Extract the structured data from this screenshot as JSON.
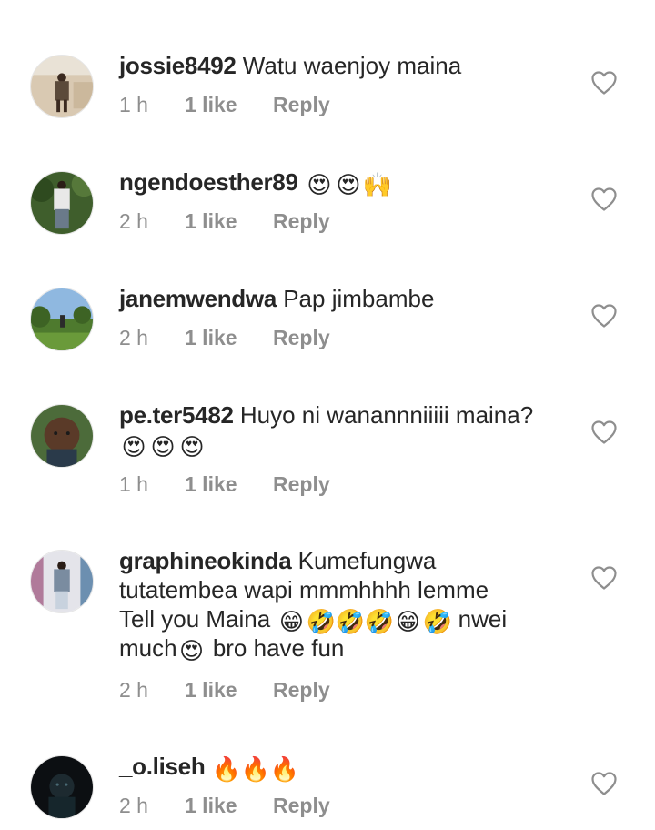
{
  "comments": [
    {
      "username": "jossie8492",
      "text": "Watu waenjoy maina",
      "emojis": [],
      "time": "1 h",
      "likes": "1 like",
      "reply": "Reply",
      "avatar_icon": "user-photo-avatar"
    },
    {
      "username": "ngendoesther89",
      "text": "",
      "emojis": [
        "😍",
        "😍",
        "🙌"
      ],
      "time": "2 h",
      "likes": "1 like",
      "reply": "Reply",
      "avatar_icon": "user-photo-avatar"
    },
    {
      "username": "janemwendwa",
      "text": "Pap jimbambe",
      "emojis": [],
      "time": "2 h",
      "likes": "1 like",
      "reply": "Reply",
      "avatar_icon": "user-photo-avatar"
    },
    {
      "username": "pe.ter5482",
      "text": "Huyo ni wanannniiiii maina?",
      "emojis": [
        "😍",
        "😍",
        "😍"
      ],
      "time": "1 h",
      "likes": "1 like",
      "reply": "Reply",
      "avatar_icon": "user-photo-avatar"
    },
    {
      "username": "graphineokinda",
      "text_line1": "Kumefungwa",
      "text_line2": "tutatembea wapi mmmhhhh lemme",
      "text_line3_start": "Tell you Maina",
      "emojis_line3": [
        "😁",
        "🤣",
        "🤣",
        "🤣",
        "😁",
        "🤣"
      ],
      "text_line3_end": "nwei",
      "text_line4_start": "much",
      "emojis_line4": [
        "😍"
      ],
      "text_line4_end": "bro have fun",
      "time": "2 h",
      "likes": "1 like",
      "reply": "Reply",
      "avatar_icon": "user-photo-avatar"
    },
    {
      "username": "_o.liseh",
      "text": "",
      "emojis": [
        "🔥",
        "🔥",
        "🔥"
      ],
      "time": "2 h",
      "likes": "1 like",
      "reply": "Reply",
      "avatar_icon": "user-photo-avatar"
    }
  ],
  "colors": {
    "text": "#262626",
    "meta": "#8e8e8e",
    "heart_outline": "#8e8e8e",
    "background": "#ffffff"
  },
  "icons": {
    "like": "heart-outline-icon"
  }
}
